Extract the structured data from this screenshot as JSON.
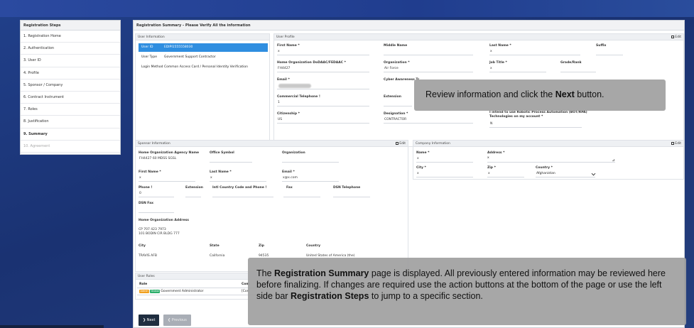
{
  "sidebar": {
    "title": "Registration Steps",
    "items": [
      {
        "label": "1. Registration Home"
      },
      {
        "label": "2. Authentication"
      },
      {
        "label": "3. User ID"
      },
      {
        "label": "4. Profile"
      },
      {
        "label": "5. Sponsor / Company"
      },
      {
        "label": "6. Contract Instrument"
      },
      {
        "label": "7. Roles"
      },
      {
        "label": "8. Justification"
      },
      {
        "label": "9. Summary"
      },
      {
        "label": "10. Agreement"
      }
    ]
  },
  "main": {
    "title": "Registration Summary - Please Verify All the information"
  },
  "user_info": {
    "title": "User Information",
    "rows": [
      {
        "key": "User ID",
        "value": "EDIPI1555558030"
      },
      {
        "key": "User Type",
        "value": "Government Support Contractor"
      },
      {
        "key": "Login Method",
        "value": "Common Access Card / Personal Identity Verification"
      }
    ]
  },
  "user_profile": {
    "title": "User Profile",
    "edit_label": "Edit",
    "first_name_label": "First Name *",
    "first_name": "x",
    "middle_name_label": "Middle Name",
    "middle_name": "",
    "last_name_label": "Last Name *",
    "last_name": "x",
    "suffix_label": "Suffix",
    "suffix": "",
    "home_org_label": "Home Organization DoDAAC/FEDAAC *",
    "home_org": "FH4427",
    "organization_label": "Organization *",
    "organization": "Air Force",
    "job_title_label": "Job Title *",
    "job_title": "x",
    "grade_label": "Grade/Rank",
    "grade": "",
    "email_label": "Email *",
    "cyber_label": "Cyber Awareness Tr",
    "phone_label": "Commercial Telephone !",
    "phone": "1",
    "extension_label": "Extension",
    "citizenship_label": "Citizenship *",
    "citizenship": "US",
    "designation_label": "Designation *",
    "designation": "CONTRACTOR",
    "rpa_label_1": "I intend to use Robotic Process Automation (BOT/RPA)",
    "rpa_label_2": "Technologies on my account *",
    "rpa_value": "N"
  },
  "sponsor": {
    "title": "Sponsor Information",
    "edit_label": "Edit",
    "agency_label": "Home Organization Agency Name",
    "agency": "FH4427 60 MDSS SGSL",
    "office_label": "Office Symbol",
    "org_label": "Organization",
    "first_name_label": "First Name *",
    "first_name": "x",
    "last_name_label": "Last Name *",
    "last_name": "x",
    "email_label": "Email *",
    "email": "x@x.com",
    "phone_label": "Phone !",
    "phone": "0",
    "extension_label": "Extension",
    "intl_label": "Intl Country Code and Phone !",
    "fax_label": "Fax",
    "dsn_phone_label": "DSN Telephone",
    "dsn_fax_label": "DSN Fax",
    "address_label": "Home Organization Address",
    "address_line1": "CP 707 423 7973",
    "address_line2": "101 BODIN CIR BLDG 777",
    "city_label": "City",
    "city": "TRAVIS AFB",
    "state_label": "State",
    "state": "California",
    "zip_label": "Zip",
    "zip": "94535",
    "country_label": "Country",
    "country": "United States of America (the)"
  },
  "company": {
    "title": "Company Information",
    "edit_label": "Edit",
    "name_label": "Name *",
    "name": "x",
    "address_label": "Address *",
    "address": "x",
    "city_label": "City *",
    "city": "x",
    "zip_label": "Zip *",
    "zip": "x",
    "country_label": "Country *",
    "country": "Afghanistan"
  },
  "roles": {
    "title": "User Roles",
    "col_role": "Role",
    "col_comment": "Com",
    "badge1": "Admin",
    "badge2": "Global",
    "role_name": "Government Administrator",
    "comment": "[Con"
  },
  "buttons": {
    "next": "Next",
    "previous": "Previous"
  },
  "callout_top": {
    "text_before": "Review information and click the ",
    "bold": "Next",
    "text_after": " button."
  },
  "callout_bottom": {
    "t1": "The ",
    "b1": "Registration Summary",
    "t2": " page is displayed. All previously entered information may be reviewed here before finalizing. If changes are required use the action buttons at the bottom of the page or use the left side bar ",
    "b2": "Registration Steps",
    "t3": " to jump to a specific section."
  },
  "colors": {
    "accent": "#2f8ee0",
    "next_button": "#1f2d3f",
    "callout": "#a0a0a0"
  }
}
